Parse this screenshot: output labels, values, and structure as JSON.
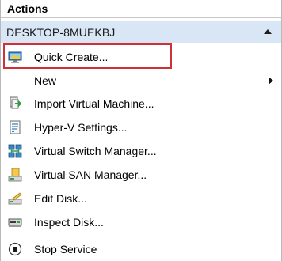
{
  "pane": {
    "title": "Actions"
  },
  "section": {
    "title": "DESKTOP-8MUEKBJ",
    "collapse_icon": "chevron-up-icon"
  },
  "items": [
    {
      "label": "Quick Create...",
      "icon": "monitor-icon"
    },
    {
      "label": "New",
      "icon": "",
      "has_submenu": true
    },
    {
      "label": "Import Virtual Machine...",
      "icon": "import-vm-icon"
    },
    {
      "label": "Hyper-V Settings...",
      "icon": "settings-document-icon"
    },
    {
      "label": "Virtual Switch Manager...",
      "icon": "network-switch-icon"
    },
    {
      "label": "Virtual SAN Manager...",
      "icon": "san-storage-icon"
    },
    {
      "label": "Edit Disk...",
      "icon": "edit-disk-icon"
    },
    {
      "label": "Inspect Disk...",
      "icon": "inspect-disk-icon"
    },
    {
      "label": "Stop Service",
      "icon": "stop-icon"
    }
  ],
  "colors": {
    "section_background": "#d9e6f5",
    "highlight_border": "#d03038"
  }
}
